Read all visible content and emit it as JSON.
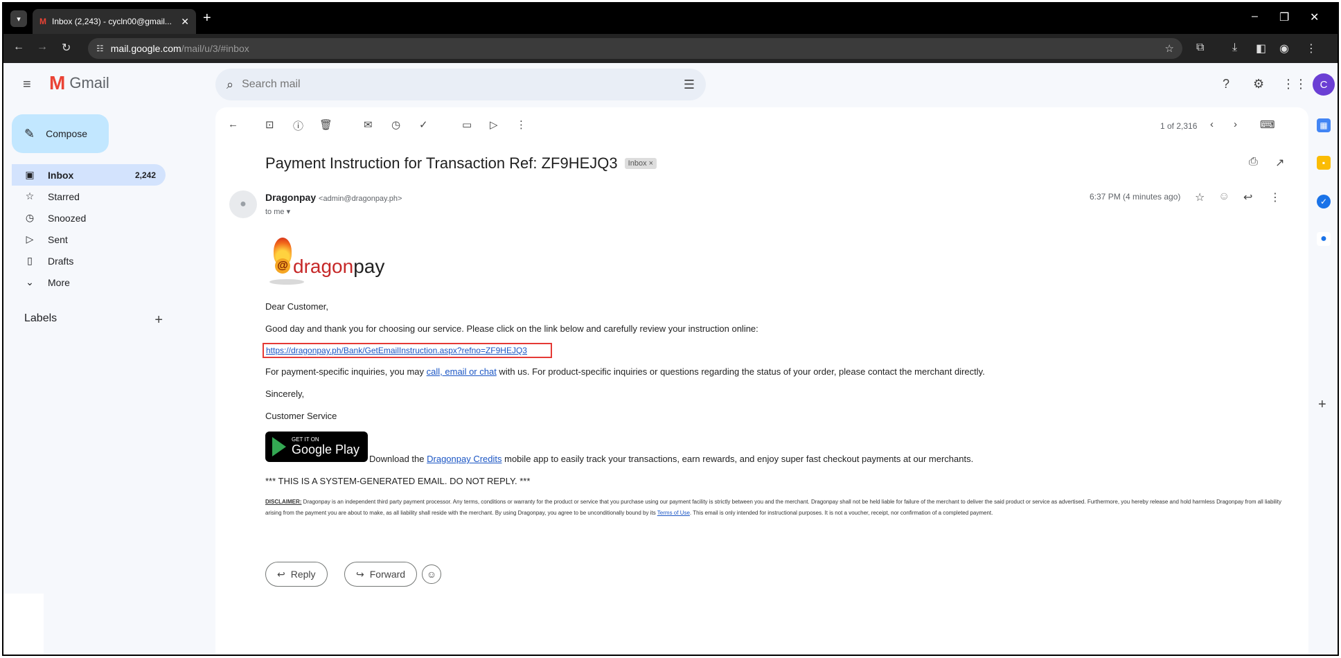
{
  "browser": {
    "tab_title": "Inbox (2,243) - cycln00@gmail...",
    "tab_favicon": "M",
    "url_host": "mail.google.com",
    "url_path": "/mail/u/3/#inbox",
    "avatar_letter": "C"
  },
  "gmail": {
    "product_name": "Gmail",
    "search_placeholder": "Search mail",
    "compose_label": "Compose"
  },
  "sidebar": {
    "items": [
      {
        "label": "Inbox",
        "icon": "inbox-icon",
        "count": "2,242"
      },
      {
        "label": "Starred",
        "icon": "star-icon",
        "count": ""
      },
      {
        "label": "Snoozed",
        "icon": "clock-icon",
        "count": ""
      },
      {
        "label": "Sent",
        "icon": "send-icon",
        "count": ""
      },
      {
        "label": "Drafts",
        "icon": "draft-icon",
        "count": ""
      },
      {
        "label": "More",
        "icon": "chevron-down-icon",
        "count": ""
      }
    ],
    "labels_heading": "Labels"
  },
  "message": {
    "pager": "1 of 2,316",
    "subject": "Payment Instruction for Transaction Ref: ZF9HEJQ3",
    "label_chip": "Inbox ×",
    "sender_name": "Dragonpay",
    "sender_email": "<admin@dragonpay.ph>",
    "recipient": "to me ▾",
    "time": "6:37 PM (4 minutes ago)"
  },
  "email_body": {
    "logo_dragon": "dragon",
    "logo_pay": "pay",
    "logo_at": "@",
    "greeting": "Dear Customer,",
    "intro": "Good day and thank you for choosing our service. Please click on the link below and carefully review your instruction online:",
    "instruction_link": "https://dragonpay.ph/Bank/GetEmailInstruction.aspx?refno=ZF9HEJQ3",
    "inquiry_pre": "For payment-specific inquiries, you may ",
    "inquiry_link": "call, email or chat",
    "inquiry_post": " with us. For product-specific inquiries or questions regarding the status of your order, please contact the merchant directly.",
    "sincerely": "Sincerely,",
    "signature": "Customer Service",
    "gplay_small": "GET IT ON",
    "gplay_big": "Google Play",
    "app_pre": "Download the ",
    "app_link": "Dragonpay Credits",
    "app_post": " mobile app to easily track your transactions, earn rewards, and enjoy super fast checkout payments at our merchants.",
    "system_notice": "*** THIS IS A SYSTEM-GENERATED EMAIL. DO NOT REPLY. ***",
    "disclaimer_heading": "DISCLAIMER:",
    "disclaimer_text": " Dragonpay is an independent third party payment processor. Any terms, conditions or warranty for the product or service that you purchase using our payment facility is strictly between you and the merchant. Dragonpay shall not be held liable for failure of the merchant to deliver the said product or service as advertised. Furthermore, you hereby release and hold harmless Dragonpay from all liability arising from the payment you are about to make, as all liability shall reside with the merchant. By using Dragonpay, you agree to be unconditionally bound by its ",
    "disclaimer_link": "Terms of Use",
    "disclaimer_end": ". This email is only intended for instructional purposes. It is not a voucher, receipt, nor confirmation of a completed payment."
  },
  "actions": {
    "reply": "Reply",
    "forward": "Forward"
  },
  "colors": {
    "compose_bg": "#c2e7ff",
    "inbox_active_bg": "#d3e3fd",
    "link": "#1a55c4",
    "highlight_box": "#e53935"
  }
}
